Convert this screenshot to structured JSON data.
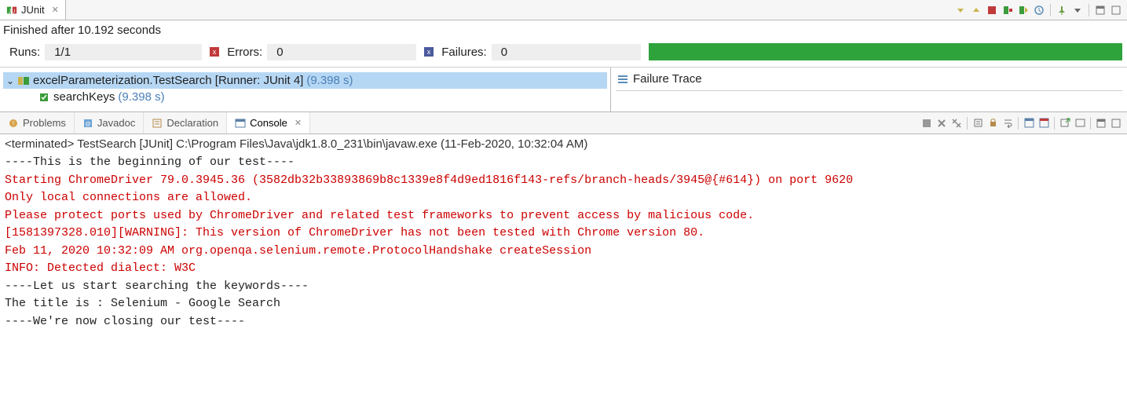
{
  "junit_tab": {
    "label": "JUnit"
  },
  "status_line": "Finished after 10.192 seconds",
  "results": {
    "runs_label": "Runs:",
    "runs_value": "1/1",
    "errors_label": "Errors:",
    "errors_value": "0",
    "failures_label": "Failures:",
    "failures_value": "0"
  },
  "tree": {
    "root": {
      "label": "excelParameterization.TestSearch [Runner: JUnit 4]",
      "duration": "(9.398 s)"
    },
    "child": {
      "label": "searchKeys",
      "duration": "(9.398 s)"
    }
  },
  "trace": {
    "header": "Failure Trace"
  },
  "bottom_tabs": {
    "problems": "Problems",
    "javadoc": "Javadoc",
    "declaration": "Declaration",
    "console": "Console"
  },
  "console_header": "<terminated> TestSearch [JUnit] C:\\Program Files\\Java\\jdk1.8.0_231\\bin\\javaw.exe (11-Feb-2020, 10:32:04 AM)",
  "console_lines": [
    {
      "text": "----This is the beginning of our test----",
      "red": false
    },
    {
      "text": "Starting ChromeDriver 79.0.3945.36 (3582db32b33893869b8c1339e8f4d9ed1816f143-refs/branch-heads/3945@{#614}) on port 9620",
      "red": true
    },
    {
      "text": "Only local connections are allowed.",
      "red": true
    },
    {
      "text": "Please protect ports used by ChromeDriver and related test frameworks to prevent access by malicious code.",
      "red": true
    },
    {
      "text": "[1581397328.010][WARNING]: This version of ChromeDriver has not been tested with Chrome version 80.",
      "red": true
    },
    {
      "text": "Feb 11, 2020 10:32:09 AM org.openqa.selenium.remote.ProtocolHandshake createSession",
      "red": true
    },
    {
      "text": "INFO: Detected dialect: W3C",
      "red": true
    },
    {
      "text": "----Let us start searching the keywords----",
      "red": false
    },
    {
      "text": "The title is : Selenium - Google Search",
      "red": false
    },
    {
      "text": "----We're now closing our test----",
      "red": false
    }
  ]
}
